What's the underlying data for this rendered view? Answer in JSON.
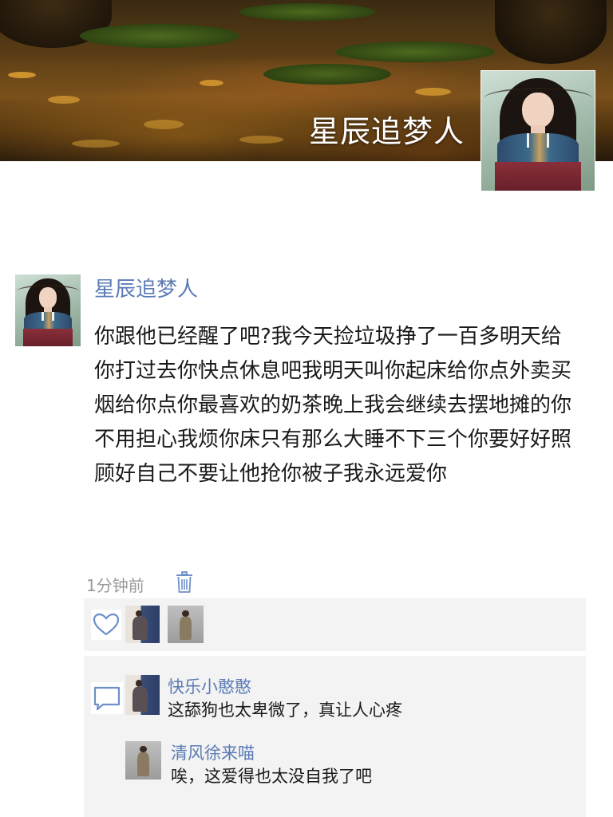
{
  "profile": {
    "cover_name": "星辰追梦人",
    "avatar_icon": "portrait-avatar"
  },
  "post": {
    "author": "星辰追梦人",
    "text": "你跟他已经醒了吧?我今天捡垃圾挣了一百多明天给你打过去你快点休息吧我明天叫你起床给你点外卖买烟给你点你最喜欢的奶茶晚上我会继续去摆地摊的你不用担心我烦你床只有那么大睡不下三个你要好好照顾好自己不要让他抢你被子我永远爱你",
    "time": "1分钟前",
    "delete_icon": "trash-icon"
  },
  "likes": {
    "icon": "heart-icon",
    "avatars": [
      "liker-avatar-1",
      "liker-avatar-2"
    ]
  },
  "comments": {
    "icon": "comment-icon",
    "items": [
      {
        "name": "快乐小憨憨",
        "text": "这舔狗也太卑微了，真让人心疼"
      },
      {
        "name": "清风徐来喵",
        "text": "唉，这爱得也太没自我了吧"
      }
    ]
  },
  "colors": {
    "name_link": "#5b7bb5",
    "meta_gray": "#9a9a9a",
    "panel_bg": "#f3f3f3"
  }
}
